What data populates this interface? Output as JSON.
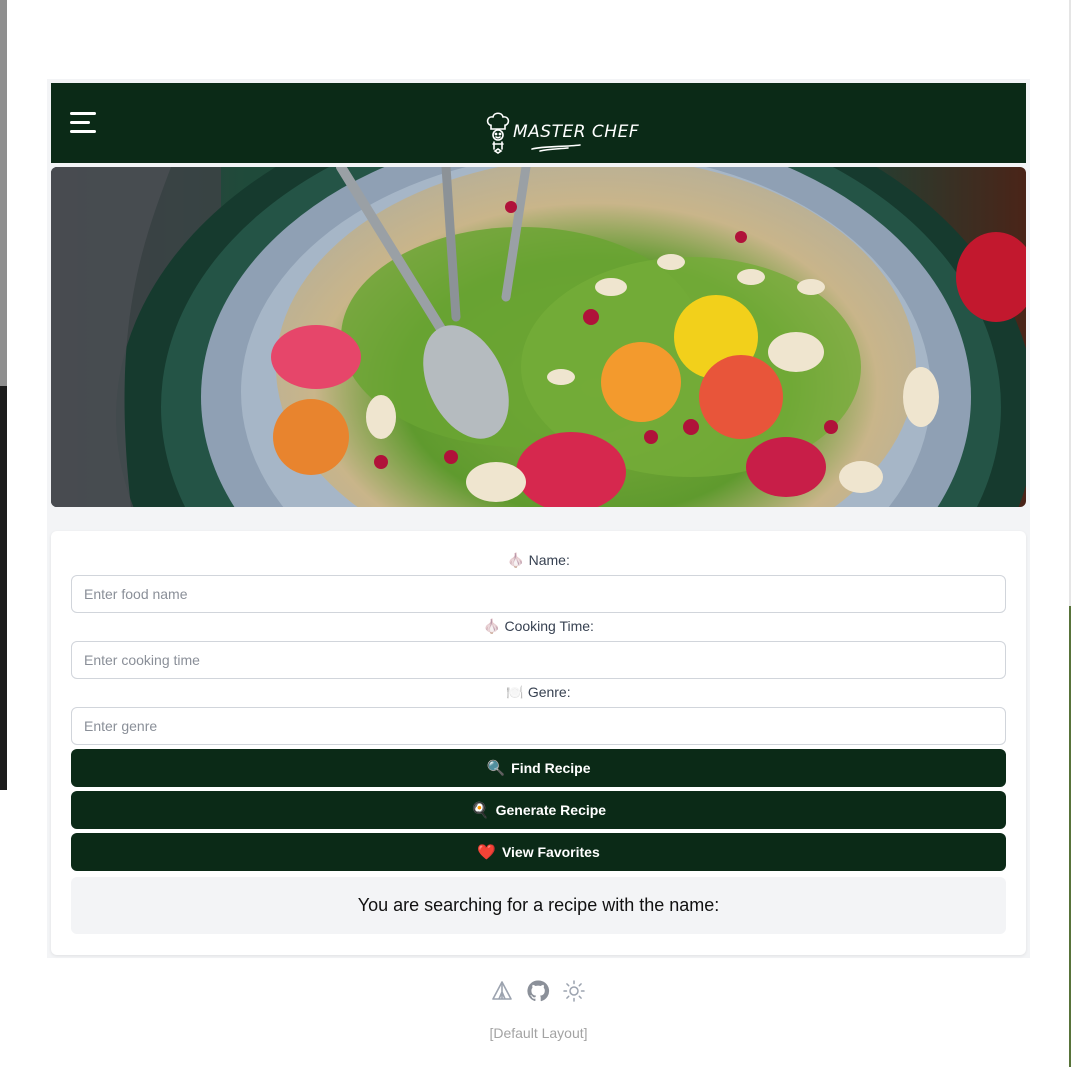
{
  "header": {
    "logo_text": "MASTER CHEF"
  },
  "form": {
    "name": {
      "emoji": "🧄",
      "label": "Name:",
      "placeholder": "Enter food name"
    },
    "cooking_time": {
      "emoji": "🧄",
      "label": "Cooking Time:",
      "placeholder": "Enter cooking time"
    },
    "genre": {
      "emoji": "🍽️",
      "label": "Genre:",
      "placeholder": "Enter genre"
    }
  },
  "buttons": {
    "find": {
      "emoji": "🔍",
      "label": "Find Recipe"
    },
    "generate": {
      "emoji": "🍳",
      "label": "Generate Recipe"
    },
    "favorites": {
      "emoji": "❤️",
      "label": "View Favorites"
    }
  },
  "result": {
    "text": "You are searching for a recipe with the name:"
  },
  "footer": {
    "icons": [
      "tent-icon",
      "github-icon",
      "sun-icon"
    ],
    "layout_label": "[Default Layout]"
  },
  "colors": {
    "header_bg": "#0b2a17",
    "button_bg": "#0b2a17",
    "panel_bg": "#f3f4f6"
  }
}
